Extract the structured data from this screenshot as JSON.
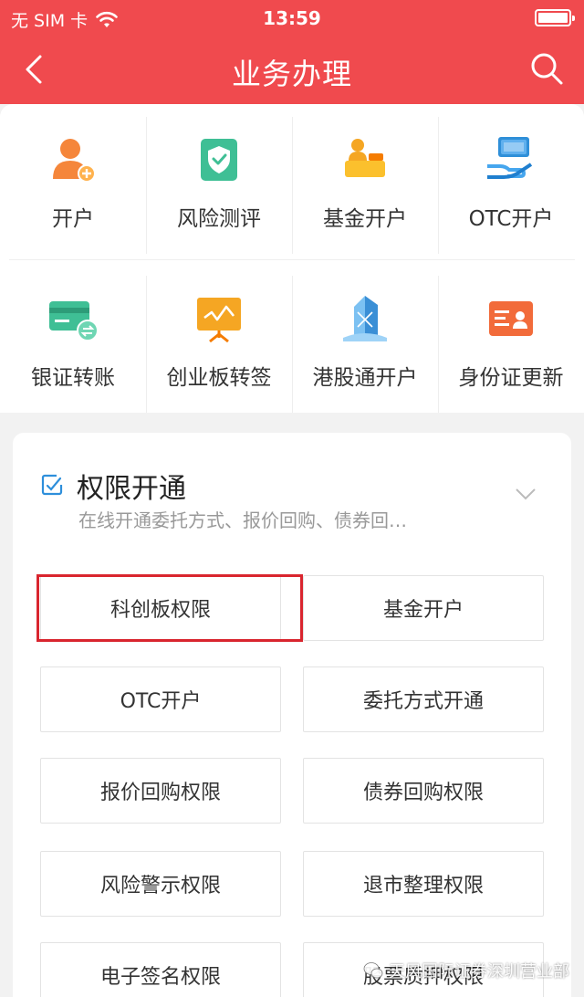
{
  "status_bar": {
    "carrier": "无 SIM 卡",
    "time": "13:59"
  },
  "nav": {
    "title": "业务办理",
    "back_icon": "chevron-left-icon",
    "search_icon": "search-icon"
  },
  "grid": {
    "items": [
      {
        "label": "开户",
        "icon": "user-add-icon"
      },
      {
        "label": "风险测评",
        "icon": "shield-check-icon"
      },
      {
        "label": "基金开户",
        "icon": "fund-account-icon"
      },
      {
        "label": "OTC开户",
        "icon": "otc-hand-icon"
      },
      {
        "label": "银证转账",
        "icon": "bank-card-transfer-icon"
      },
      {
        "label": "创业板转签",
        "icon": "chinext-board-icon"
      },
      {
        "label": "港股通开户",
        "icon": "hk-connect-icon"
      },
      {
        "label": "身份证更新",
        "icon": "id-card-icon"
      }
    ]
  },
  "permissions": {
    "title": "权限开通",
    "subtitle": "在线开通委托方式、报价回购、债券回…",
    "header_icon": "edit-checklist-icon",
    "expand_icon": "chevron-down-icon",
    "buttons": [
      "科创板权限",
      "基金开户",
      "OTC开户",
      "委托方式开通",
      "报价回购权限",
      "债券回购权限",
      "风险警示权限",
      "退市整理权限",
      "电子签名权限",
      "股票质押权限"
    ],
    "highlighted": "科创板权限"
  },
  "watermark": {
    "text": "天风国际证券深圳营业部"
  },
  "colors": {
    "brand": "#f04a4e",
    "highlight": "#d9252e"
  }
}
